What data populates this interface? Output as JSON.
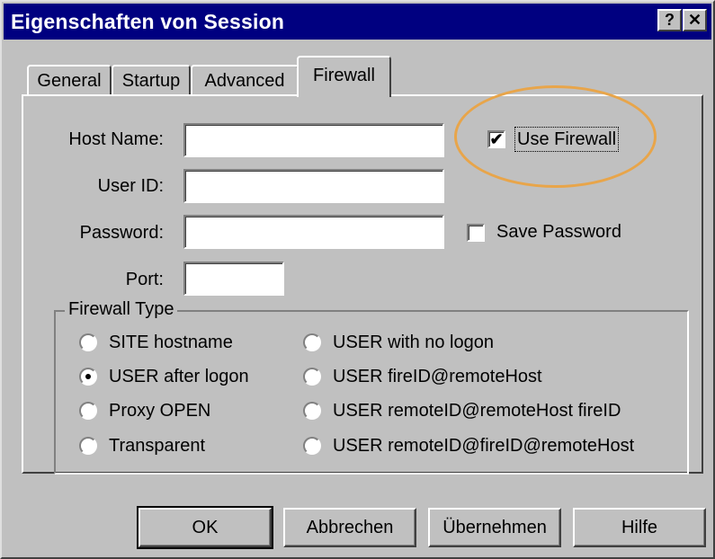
{
  "window": {
    "title": "Eigenschaften von Session",
    "help_button": "?",
    "close_button": "✕"
  },
  "tabs": [
    {
      "label": "General",
      "active": false
    },
    {
      "label": "Startup",
      "active": false
    },
    {
      "label": "Advanced",
      "active": false
    },
    {
      "label": "Firewall",
      "active": true
    }
  ],
  "form": {
    "host_name": {
      "label": "Host Name:",
      "value": ""
    },
    "user_id": {
      "label": "User ID:",
      "value": ""
    },
    "password": {
      "label": "Password:",
      "value": ""
    },
    "port": {
      "label": "Port:",
      "value": ""
    },
    "use_firewall": {
      "label": "Use Firewall",
      "checked": true
    },
    "save_password": {
      "label": "Save Password",
      "checked": false
    }
  },
  "firewall_type": {
    "legend": "Firewall Type",
    "options": [
      {
        "label": "SITE hostname",
        "selected": false
      },
      {
        "label": "USER after logon",
        "selected": true
      },
      {
        "label": "Proxy OPEN",
        "selected": false
      },
      {
        "label": "Transparent",
        "selected": false
      },
      {
        "label": "USER with no logon",
        "selected": false
      },
      {
        "label": "USER fireID@remoteHost",
        "selected": false
      },
      {
        "label": "USER remoteID@remoteHost fireID",
        "selected": false
      },
      {
        "label": "USER remoteID@fireID@remoteHost",
        "selected": false
      }
    ]
  },
  "buttons": {
    "ok": "OK",
    "cancel": "Abbrechen",
    "apply": "Übernehmen",
    "help": "Hilfe"
  },
  "colors": {
    "titlebar": "#000080",
    "face": "#c0c0c0",
    "highlight_oval": "#e8a54a"
  },
  "icons": {
    "checkbox_checked": "check-mark-icon",
    "radio_selected": "radio-dot-icon"
  }
}
